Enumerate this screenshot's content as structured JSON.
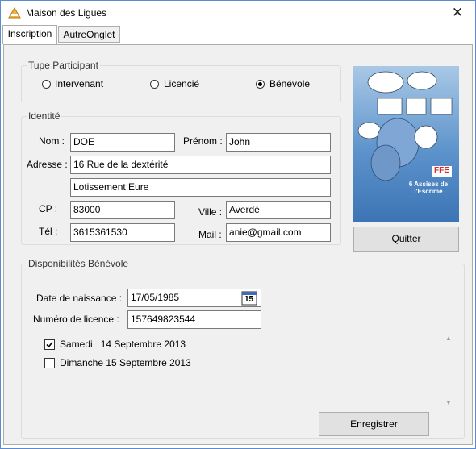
{
  "window": {
    "title": "Maison des Ligues"
  },
  "tabs": [
    {
      "label": "Inscription"
    },
    {
      "label": "AutreOnglet"
    }
  ],
  "type_participant": {
    "title": "Tupe Participant",
    "options": [
      "Intervenant",
      "Licencié",
      "Bénévole"
    ],
    "selected": "Bénévole"
  },
  "identite": {
    "title": "Identité",
    "nom_label": "Nom :",
    "nom_value": "DOE",
    "prenom_label": "Prénom :",
    "prenom_value": "John",
    "adresse_label": "Adresse :",
    "adresse_line1": "16 Rue de la dextérité",
    "adresse_line2": "Lotissement Eure",
    "cp_label": "CP :",
    "cp_value": "83000",
    "ville_label": "Ville :",
    "ville_value": "Averdé",
    "tel_label": "Tél :",
    "tel_value": "3615361530",
    "mail_label": "Mail :",
    "mail_value": "anie@gmail.com"
  },
  "poster": {
    "logo": "FFE",
    "headline": "6 Assises de l'Escrime"
  },
  "quitter_label": "Quitter",
  "disponibilites": {
    "title": "Disponibilités Bénévole",
    "date_label": "Date de naissance :",
    "date_value": "17/05/1985",
    "calendar_day": "15",
    "licence_label": "Numéro de licence :",
    "licence_value": "157649823544",
    "days": [
      {
        "label": "Samedi   14 Septembre 2013",
        "checked": true
      },
      {
        "label": "Dimanche 15 Septembre 2013",
        "checked": false
      }
    ]
  },
  "enregistrer_label": "Enregistrer",
  "colors": {
    "window_border": "#5a8bd0",
    "panel_bg": "#f0f0f0",
    "poster_blue": "#5c93cb",
    "logo_red": "#d32f2f"
  }
}
